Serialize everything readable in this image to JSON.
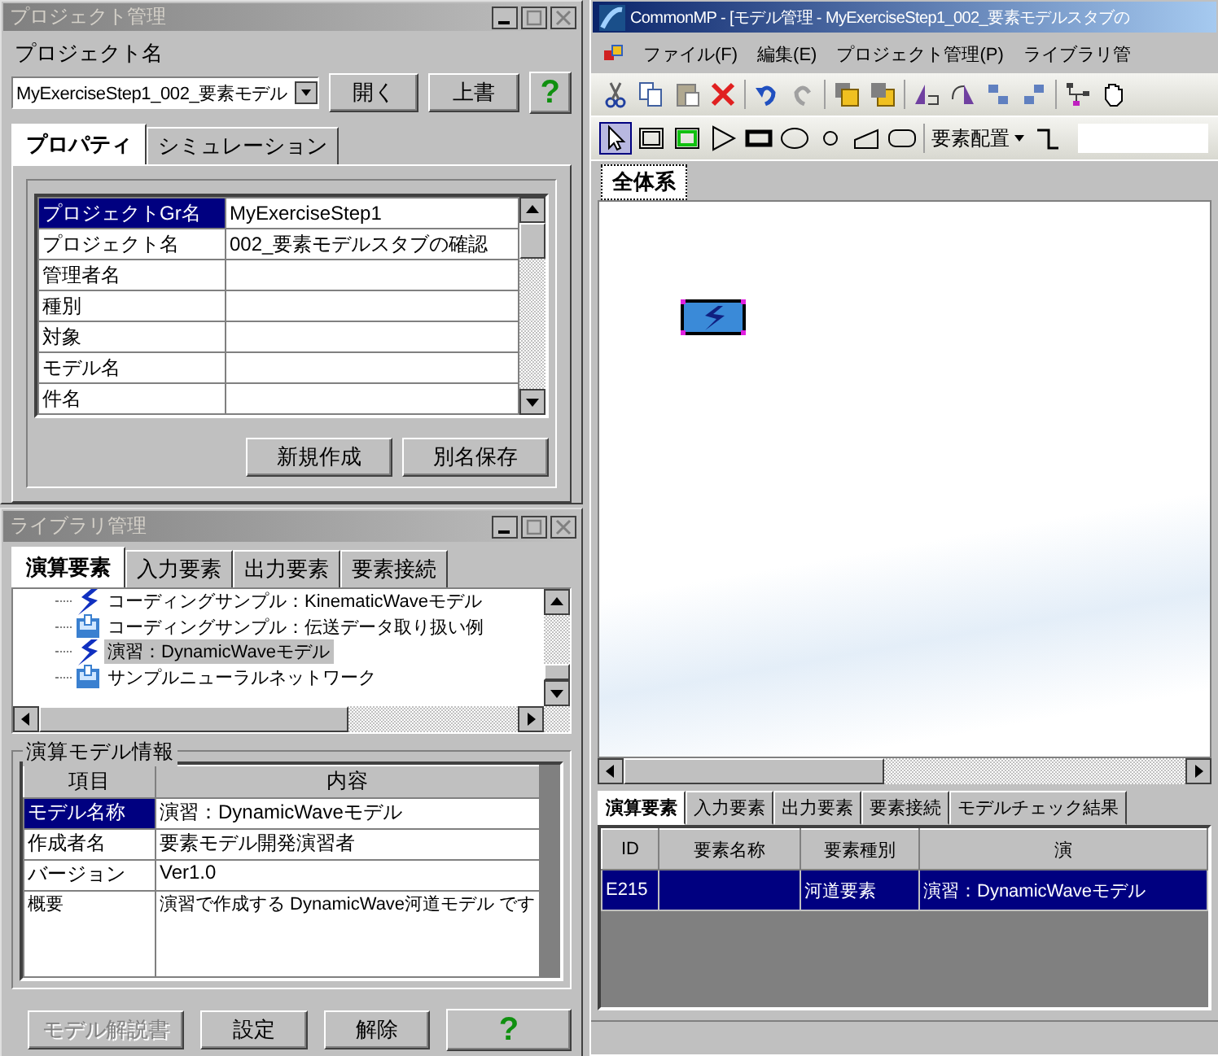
{
  "project_window": {
    "title": "プロジェクト管理",
    "project_label": "プロジェクト名",
    "project_select": "MyExerciseStep1_002_要素モデル",
    "buttons": [
      "開く",
      "上書"
    ],
    "help": "?",
    "tabs": [
      {
        "label": "プロパティ",
        "selected": true
      },
      {
        "label": "シミュレーション",
        "selected": false
      }
    ],
    "properties": [
      {
        "name": "プロジェクトGr名",
        "value": "MyExerciseStep1",
        "selected": true
      },
      {
        "name": "プロジェクト名",
        "value": "002_要素モデルスタブの確認",
        "selected": false
      },
      {
        "name": "管理者名",
        "selected": false
      },
      {
        "name": "種別",
        "selected": false
      },
      {
        "name": "対象",
        "selected": false
      },
      {
        "name": "モデル名",
        "selected": false
      },
      {
        "name": "件名",
        "selected": false
      }
    ],
    "actions": [
      "新規作成",
      "別名保存"
    ]
  },
  "library_window": {
    "title": "ライブラリ管理",
    "tabs": [
      {
        "label": "演算要素",
        "selected": true
      },
      {
        "label": "入力要素",
        "selected": false
      },
      {
        "label": "出力要素",
        "selected": false
      },
      {
        "label": "要素接続",
        "selected": false
      }
    ],
    "tree_items": [
      {
        "label": "コーディングサンプル：KinematicWaveモデル",
        "kind": "wave",
        "selected": false
      },
      {
        "label": "コーディングサンプル：伝送データ取り扱い例",
        "kind": "transfer",
        "selected": false
      },
      {
        "label": "演習：DynamicWaveモデル",
        "kind": "wave",
        "selected": true
      },
      {
        "label": "サンプルニューラルネットワーク",
        "kind": "transfer",
        "selected": false
      }
    ],
    "info_title": "演算モデル情報",
    "info_columns": [
      "項目",
      "内容"
    ],
    "info_rows": [
      {
        "name": "モデル名称",
        "value": "演習：DynamicWaveモデル",
        "selected": true
      },
      {
        "name": "作成者名",
        "value": "要素モデル開発演習者",
        "selected": false
      },
      {
        "name": "バージョン",
        "value": "Ver1.0",
        "selected": false
      },
      {
        "name": "概要",
        "value": "演習で作成する DynamicWave河道モデル です",
        "selected": false
      }
    ],
    "buttons": [
      {
        "label": "モデル解説書",
        "disabled": true
      },
      {
        "label": "設定",
        "disabled": false
      },
      {
        "label": "解除",
        "disabled": false
      }
    ],
    "help": "?"
  },
  "main_window": {
    "title": "CommonMP - [モデル管理 - MyExerciseStep1_002_要素モデルスタブの",
    "menu": [
      "ファイル(F)",
      "編集(E)",
      "プロジェクト管理(P)",
      "ライブラリ管"
    ],
    "arrange_label": "要素配置",
    "canvas_tabs": [
      {
        "label": "全体系",
        "selected": true
      }
    ],
    "bottom_tabs": [
      {
        "label": "演算要素",
        "selected": true
      },
      {
        "label": "入力要素",
        "selected": false
      },
      {
        "label": "出力要素",
        "selected": false
      },
      {
        "label": "要素接続",
        "selected": false
      },
      {
        "label": "モデルチェック結果",
        "selected": false
      }
    ],
    "columns": [
      "ID",
      "要素名称",
      "要素種別",
      "演"
    ],
    "rows": [
      {
        "cells": [
          "E215",
          "",
          "河道要素",
          "演習：DynamicWaveモデル"
        ],
        "selected": true
      }
    ]
  }
}
